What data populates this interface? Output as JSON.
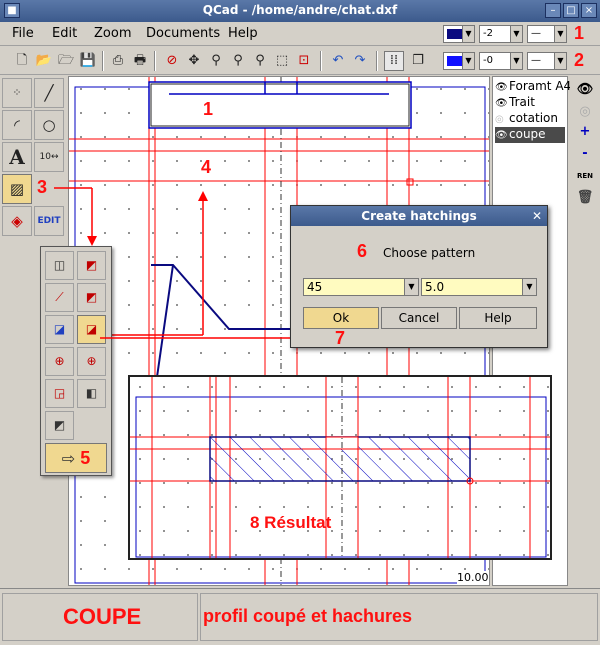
{
  "window": {
    "title": "QCad - /home/andre/chat.dxf",
    "buttons": [
      "–",
      "□",
      "×"
    ]
  },
  "menu": [
    "File",
    "Edit",
    "Zoom",
    "Documents",
    "Help"
  ],
  "toolbar": {
    "line_width_1": "-2",
    "line_style_1": "—",
    "line_width_2": "-0",
    "line_style_2": "—",
    "color_1": "#0a0a80",
    "color_2": "#1010ff",
    "label_1": "1",
    "label_2": "2"
  },
  "left_toolbar": {
    "text_tool_label": "A",
    "edit_label": "EDIT",
    "dimension_label": "10",
    "label_3": "3"
  },
  "popup": {
    "label_5": "5",
    "confirm_arrow": "⇨"
  },
  "layers": [
    {
      "name": "Foramt A4",
      "selected": false
    },
    {
      "name": "Trait",
      "selected": false
    },
    {
      "name": "cotation",
      "selected": false
    },
    {
      "name": "coupe",
      "selected": true
    }
  ],
  "right_toolbar": {
    "add": "+",
    "remove": "-",
    "rename": "REN"
  },
  "canvas": {
    "label_1": "1",
    "label_4": "4",
    "scale": "10.00"
  },
  "dialog": {
    "title": "Create hatchings",
    "label_6": "6",
    "prompt": "Choose pattern",
    "pattern_value": "45",
    "scale_value": "5.0",
    "ok": "Ok",
    "cancel": "Cancel",
    "help": "Help",
    "label_7": "7"
  },
  "zoom": {
    "result_label": "8 Résultat"
  },
  "status": {
    "title": "COUPE",
    "subtitle": "profil coupé et hachures"
  },
  "colors": {
    "annotation": "#ff1010",
    "geometry_red": "#ff0000",
    "geometry_blue": "#0000c0"
  }
}
